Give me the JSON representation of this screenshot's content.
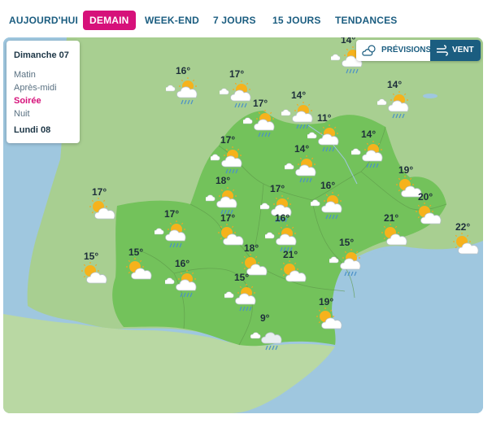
{
  "tabs": [
    {
      "label": "AUJOURD'HUI",
      "active": false
    },
    {
      "label": "DEMAIN",
      "active": true
    },
    {
      "label": "WEEK-END",
      "active": false
    },
    {
      "label": "7 JOURS",
      "active": false
    },
    {
      "label": "15 JOURS",
      "active": false
    },
    {
      "label": "TENDANCES",
      "active": false
    }
  ],
  "day_panel": {
    "day": "Dimanche 07",
    "slots": [
      "Matin",
      "Après-midi",
      "Soirée",
      "Nuit"
    ],
    "active_slot": "Soirée",
    "next_day": "Lundi 08"
  },
  "view_toggle": {
    "previsions_label": "PRÉVISIONS",
    "previsions_icon": "cloud-sun-icon",
    "vent_label": "VENT",
    "vent_icon": "wind-icon",
    "active": "VENT"
  },
  "colors": {
    "accent": "#d6117a",
    "brand": "#1b5d80",
    "land_region": "#73c25b",
    "land_outside": "#a8cf91",
    "sea": "#9fc7df"
  },
  "forecasts": [
    {
      "temp": "14°",
      "icon": "sun-cloud-rain"
    },
    {
      "temp": "16°",
      "icon": "sun-cloud-rain"
    },
    {
      "temp": "17°",
      "icon": "sun-cloud-rain"
    },
    {
      "temp": "14°",
      "icon": "sun-cloud-rain"
    },
    {
      "temp": "14°",
      "icon": "sun-cloud-rain"
    },
    {
      "temp": "17°",
      "icon": "sun-cloud-rain"
    },
    {
      "temp": "11°",
      "icon": "sun-cloud-rain"
    },
    {
      "temp": "14°",
      "icon": "sun-cloud-rain"
    },
    {
      "temp": "17°",
      "icon": "sun-cloud-rain"
    },
    {
      "temp": "14°",
      "icon": "sun-cloud-rain"
    },
    {
      "temp": "19°",
      "icon": "sun-cloud"
    },
    {
      "temp": "18°",
      "icon": "sun-cloud-rain"
    },
    {
      "temp": "17°",
      "icon": "sun-cloud-rain"
    },
    {
      "temp": "16°",
      "icon": "sun-cloud-rain"
    },
    {
      "temp": "17°",
      "icon": "sun-cloud"
    },
    {
      "temp": "20°",
      "icon": "sun-cloud"
    },
    {
      "temp": "17°",
      "icon": "sun-cloud-rain"
    },
    {
      "temp": "17°",
      "icon": "sun-cloud"
    },
    {
      "temp": "16°",
      "icon": "sun-cloud-rain"
    },
    {
      "temp": "21°",
      "icon": "sun-cloud"
    },
    {
      "temp": "22°",
      "icon": "sun-cloud"
    },
    {
      "temp": "15°",
      "icon": "sun-cloud"
    },
    {
      "temp": "15°",
      "icon": "sun-cloud"
    },
    {
      "temp": "16°",
      "icon": "sun-cloud-rain"
    },
    {
      "temp": "18°",
      "icon": "sun-cloud"
    },
    {
      "temp": "21°",
      "icon": "sun-cloud"
    },
    {
      "temp": "15°",
      "icon": "sun-cloud-rain"
    },
    {
      "temp": "15°",
      "icon": "sun-cloud-rain"
    },
    {
      "temp": "9°",
      "icon": "cloud-rain"
    },
    {
      "temp": "19°",
      "icon": "sun-cloud"
    }
  ]
}
